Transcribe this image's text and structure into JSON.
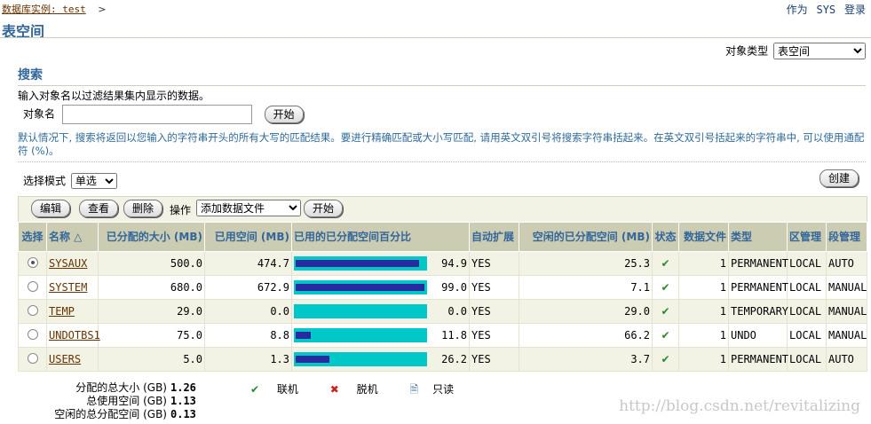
{
  "breadcrumb": {
    "label": "数据库实例: test"
  },
  "user": {
    "as": "作为",
    "name": "SYS",
    "login": "登录"
  },
  "page_title": "表空间",
  "object_type": {
    "label": "对象类型",
    "selected": "表空间"
  },
  "search": {
    "title": "搜索",
    "description": "输入对象名以过滤结果集内显示的数据。",
    "object_name_label": "对象名",
    "object_name_value": "",
    "go_button": "开始",
    "hint": "默认情况下, 搜索将返回以您输入的字符串开头的所有大写的匹配结果。要进行精确匹配或大小写匹配, 请用英文双引号将搜索字符串括起来。在英文双引号括起来的字符串中, 可以使用通配符 (%)。"
  },
  "selection_mode": {
    "label": "选择模式",
    "selected": "单选"
  },
  "create_button": "创建",
  "toolbar": {
    "edit": "编辑",
    "view": "查看",
    "delete": "删除",
    "action_label": "操作",
    "action_selected": "添加数据文件",
    "go": "开始"
  },
  "table": {
    "headers": {
      "select": "选择",
      "name": "名称 △",
      "allocated": "已分配的大小 (MB)",
      "used": "已用空间 (MB)",
      "used_pct": "已用的已分配空间百分比",
      "autoextend": "自动扩展",
      "free": "空闲的已分配空间 (MB)",
      "status": "状态",
      "datafiles": "数据文件",
      "type": "类型",
      "extent_mgmt": "区管理",
      "segment_mgmt": "段管理"
    },
    "rows": [
      {
        "selected": true,
        "name": "SYSAUX",
        "allocated": "500.0",
        "used": "474.7",
        "pct": 94.9,
        "pct_text": "94.9",
        "autoextend": "YES",
        "free": "25.3",
        "status": "✔",
        "datafiles": "1",
        "type": "PERMANENT",
        "extent": "LOCAL",
        "segment": "AUTO"
      },
      {
        "selected": false,
        "name": "SYSTEM",
        "allocated": "680.0",
        "used": "672.9",
        "pct": 99.0,
        "pct_text": "99.0",
        "autoextend": "YES",
        "free": "7.1",
        "status": "✔",
        "datafiles": "1",
        "type": "PERMANENT",
        "extent": "LOCAL",
        "segment": "MANUAL"
      },
      {
        "selected": false,
        "name": "TEMP",
        "allocated": "29.0",
        "used": "0.0",
        "pct": 0.0,
        "pct_text": "0.0",
        "autoextend": "YES",
        "free": "29.0",
        "status": "✔",
        "datafiles": "1",
        "type": "TEMPORARY",
        "extent": "LOCAL",
        "segment": "MANUAL"
      },
      {
        "selected": false,
        "name": "UNDOTBS1",
        "allocated": "75.0",
        "used": "8.8",
        "pct": 11.8,
        "pct_text": "11.8",
        "autoextend": "YES",
        "free": "66.2",
        "status": "✔",
        "datafiles": "1",
        "type": "UNDO",
        "extent": "LOCAL",
        "segment": "MANUAL"
      },
      {
        "selected": false,
        "name": "USERS",
        "allocated": "5.0",
        "used": "1.3",
        "pct": 26.2,
        "pct_text": "26.2",
        "autoextend": "YES",
        "free": "3.7",
        "status": "✔",
        "datafiles": "1",
        "type": "PERMANENT",
        "extent": "LOCAL",
        "segment": "AUTO"
      }
    ]
  },
  "summary": {
    "allocated_total_label": "分配的总大小 (GB)",
    "allocated_total": "1.26",
    "used_total_label": "总使用空间 (GB)",
    "used_total": "1.13",
    "free_total_label": "空闲的总分配空间 (GB)",
    "free_total": "0.13"
  },
  "legend": {
    "online": "联机",
    "offline": "脱机",
    "readonly": "只读"
  },
  "colors": {
    "header_bg": "#ccccb3",
    "header_text": "#336699",
    "bar_bg": "#00c8c8",
    "bar_fill": "#2a2aa0"
  },
  "watermark": "http://blog.csdn.net/revitalizing"
}
